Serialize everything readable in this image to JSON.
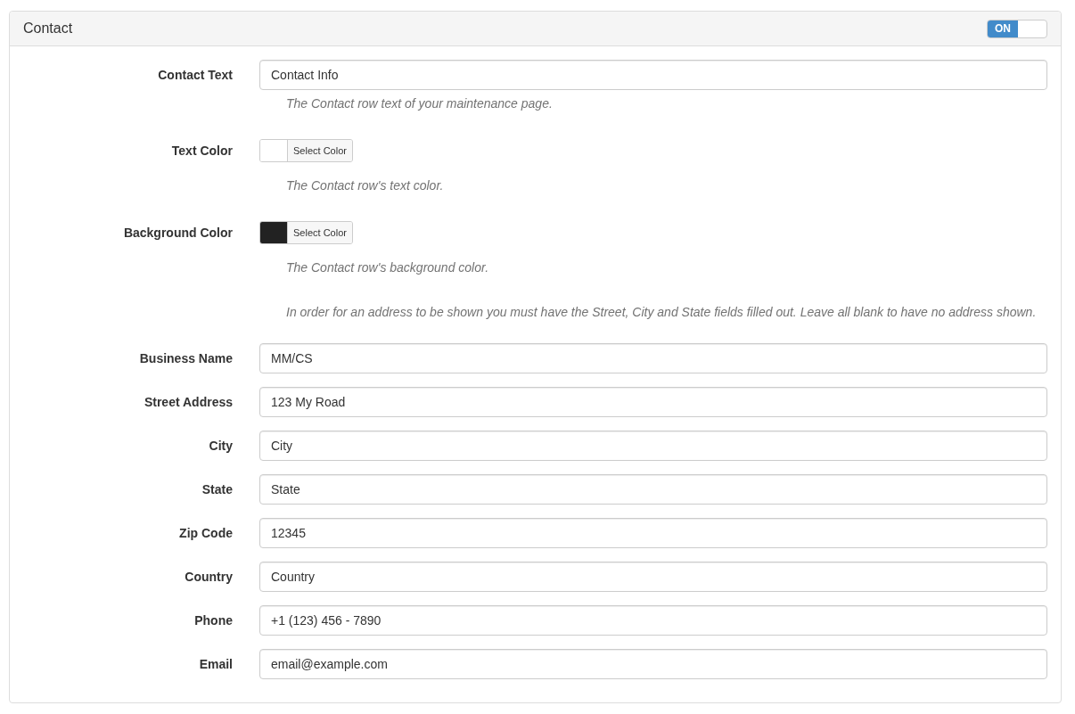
{
  "panel": {
    "title": "Contact",
    "toggle": {
      "label": "ON",
      "on": true
    }
  },
  "fields": [
    {
      "kind": "text",
      "label": "Contact Text",
      "value": "Contact Info",
      "help": "The Contact row text of your maintenance page."
    },
    {
      "kind": "color",
      "label": "Text Color",
      "color": "#ffffff",
      "button": "Select Color",
      "help": "The Contact row's text color."
    },
    {
      "kind": "color",
      "label": "Background Color",
      "color": "#222222",
      "button": "Select Color",
      "help": "The Contact row's background color."
    },
    {
      "kind": "note",
      "help": "In order for an address to be shown you must have the Street, City and State fields filled out. Leave all blank to have no address shown."
    },
    {
      "kind": "text",
      "label": "Business Name",
      "value": "MM/CS"
    },
    {
      "kind": "text",
      "label": "Street Address",
      "value": "123 My Road"
    },
    {
      "kind": "text",
      "label": "City",
      "value": "City"
    },
    {
      "kind": "text",
      "label": "State",
      "value": "State"
    },
    {
      "kind": "text",
      "label": "Zip Code",
      "value": "12345"
    },
    {
      "kind": "text",
      "label": "Country",
      "value": "Country"
    },
    {
      "kind": "text",
      "label": "Phone",
      "value": "+1 (123) 456 - 7890"
    },
    {
      "kind": "text",
      "label": "Email",
      "value": "email@example.com"
    }
  ]
}
